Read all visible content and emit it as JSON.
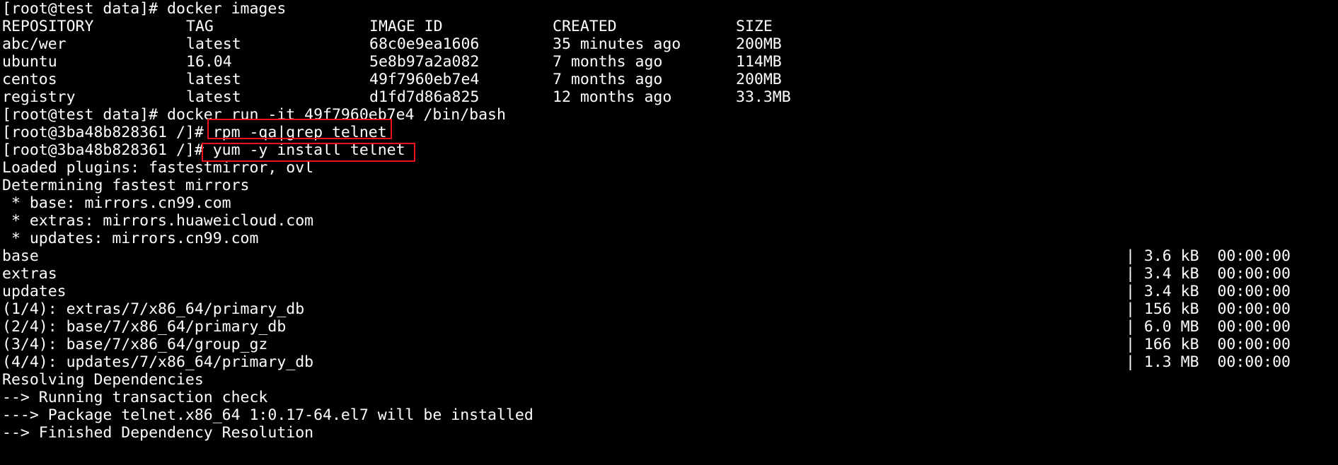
{
  "highlight_color": "#e8141b",
  "lines": [
    {
      "text": "[root@test data]# docker images"
    },
    {
      "cols": [
        "REPOSITORY",
        "TAG",
        "IMAGE ID",
        "CREATED",
        "SIZE"
      ]
    },
    {
      "cols": [
        "abc/wer",
        "latest",
        "68c0e9ea1606",
        "35 minutes ago",
        "200MB"
      ]
    },
    {
      "cols": [
        "ubuntu",
        "16.04",
        "5e8b97a2a082",
        "7 months ago",
        "114MB"
      ]
    },
    {
      "cols": [
        "centos",
        "latest",
        "49f7960eb7e4",
        "7 months ago",
        "200MB"
      ]
    },
    {
      "cols": [
        "registry",
        "latest",
        "d1fd7d86a825",
        "12 months ago",
        "33.3MB"
      ]
    },
    {
      "text": "[root@test data]# docker run -it 49f7960eb7e4 /bin/bash"
    },
    {
      "text": "[root@3ba48b828361 /]# rpm -qa|grep telnet"
    },
    {
      "text": "[root@3ba48b828361 /]# yum -y install telnet"
    },
    {
      "text": "Loaded plugins: fastestmirror, ovl"
    },
    {
      "text": "Determining fastest mirrors"
    },
    {
      "text": " * base: mirrors.cn99.com"
    },
    {
      "text": " * extras: mirrors.huaweicloud.com"
    },
    {
      "text": " * updates: mirrors.cn99.com"
    },
    {
      "text": "base",
      "right": "| 3.6 kB  00:00:00"
    },
    {
      "text": "extras",
      "right": "| 3.4 kB  00:00:00"
    },
    {
      "text": "updates",
      "right": "| 3.4 kB  00:00:00"
    },
    {
      "text": "(1/4): extras/7/x86_64/primary_db",
      "right": "| 156 kB  00:00:00"
    },
    {
      "text": "(2/4): base/7/x86_64/primary_db",
      "right": "| 6.0 MB  00:00:00"
    },
    {
      "text": "(3/4): base/7/x86_64/group_gz",
      "right": "| 166 kB  00:00:00"
    },
    {
      "text": "(4/4): updates/7/x86_64/primary_db",
      "right": "| 1.3 MB  00:00:00"
    },
    {
      "text": "Resolving Dependencies"
    },
    {
      "text": "--> Running transaction check"
    },
    {
      "text": "---> Package telnet.x86_64 1:0.17-64.el7 will be installed"
    },
    {
      "text": "--> Finished Dependency Resolution"
    }
  ]
}
